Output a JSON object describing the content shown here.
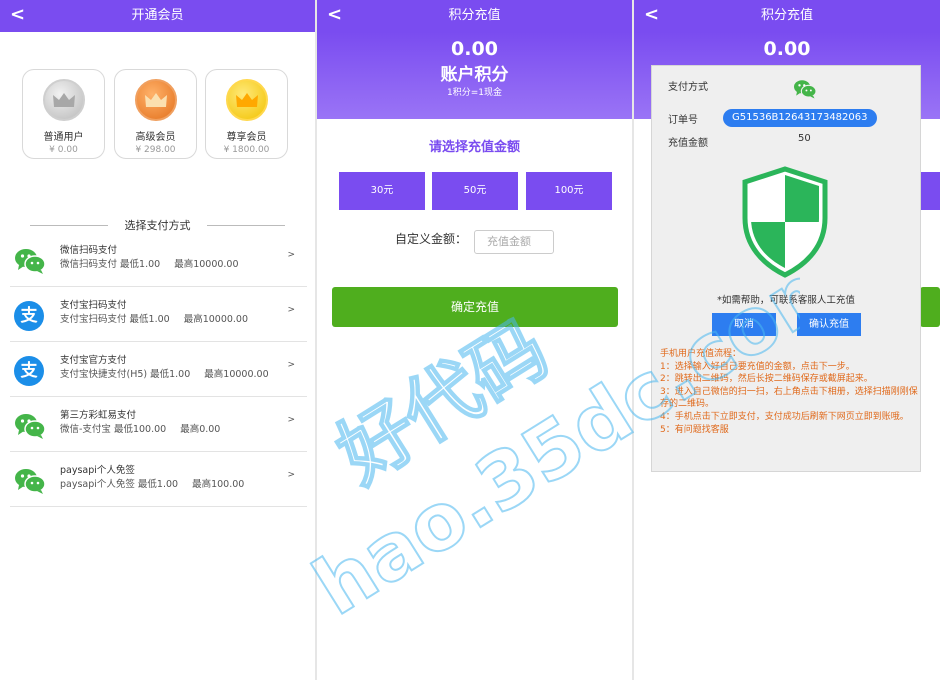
{
  "panel1": {
    "header": {
      "back": "<",
      "title": "开通会员"
    },
    "tiers": [
      {
        "name": "普通用户",
        "price": "¥ 0.00",
        "color": "silver"
      },
      {
        "name": "高级会员",
        "price": "¥ 298.00",
        "color": "bronze"
      },
      {
        "name": "尊享会员",
        "price": "¥ 1800.00",
        "color": "gold"
      }
    ],
    "section_title": "选择支付方式",
    "payments": [
      {
        "icon": "wechat-icon",
        "name": "微信扫码支付",
        "desc": "微信扫码支付 最低1.00",
        "max": "最高10000.00",
        "arrow": ">"
      },
      {
        "icon": "alipay-icon",
        "name": "支付宝扫码支付",
        "desc": "支付宝扫码支付 最低1.00",
        "max": "最高10000.00",
        "arrow": ">"
      },
      {
        "icon": "alipay-icon",
        "name": "支付宝官方支付",
        "desc": "支付宝快捷支付(H5) 最低1.00",
        "max": "最高10000.00",
        "arrow": ">"
      },
      {
        "icon": "wechat-icon",
        "name": "第三方彩虹易支付",
        "desc": "微信-支付宝 最低100.00",
        "max": "最高0.00",
        "arrow": ">"
      },
      {
        "icon": "wechat-icon",
        "name": "paysapi个人免签",
        "desc": "paysapi个人免签 最低1.00",
        "max": "最高100.00",
        "arrow": ">"
      }
    ],
    "alipay_glyph": "支"
  },
  "panel2": {
    "header": {
      "back": "<",
      "title": "积分充值"
    },
    "balance": "0.00",
    "balance_label": "账户积分",
    "rate": "1积分=1现金",
    "choose_title": "请选择充值金额",
    "amounts": [
      "30元",
      "50元",
      "100元"
    ],
    "custom_label": "自定义金额：",
    "custom_placeholder": "充值金额",
    "confirm_label": "确定充值"
  },
  "panel3": {
    "header": {
      "back": "<",
      "title": "积分充值"
    },
    "balance": "0.00",
    "modal": {
      "pay_method_label": "支付方式",
      "order_label": "订单号",
      "order_no": "G51536B12643173482063",
      "amount_label": "充值金额",
      "amount": "50",
      "help": "*如需帮助，可联系客服人工充值",
      "cancel": "取消",
      "confirm": "确认充值",
      "steps": [
        "手机用户充值流程：",
        "1：选择输入好自己要充值的金额，点击下一步。",
        "2：跳转出二维码，然后长按二维码保存或截屏起来。",
        "3：进入自己微信的扫一扫，右上角点击下相册，选择扫描刚刚保存的二维码。",
        "4：手机点击下立即支付，支付成功后刷新下网页立即到账哦。",
        "5：有问题找客服"
      ]
    }
  },
  "watermark": {
    "line1": "好代码",
    "line2": "hao.35dc.com"
  },
  "colors": {
    "purple": "#7a4cf0",
    "green": "#4fae1e",
    "blue": "#2d7df0",
    "orange": "#e06a1c",
    "wechat": "#44b549",
    "alipay": "#1b8ee8"
  }
}
